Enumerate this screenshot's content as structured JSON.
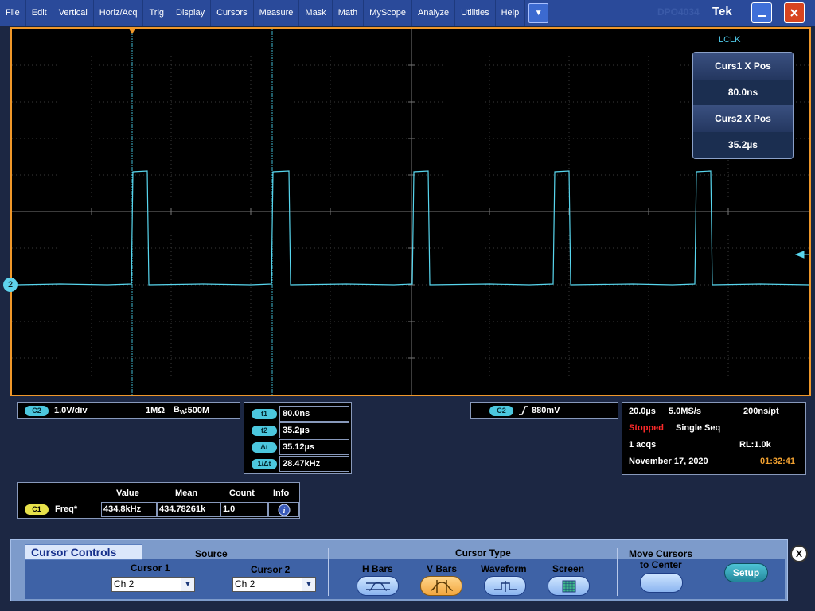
{
  "menu": [
    "File",
    "Edit",
    "Vertical",
    "Horiz/Acq",
    "Trig",
    "Display",
    "Cursors",
    "Measure",
    "Mask",
    "Math",
    "MyScope",
    "Analyze",
    "Utilities",
    "Help"
  ],
  "window": {
    "brand_text": "DPO4034",
    "logo": "Tek",
    "minimize_icon": "minimize-icon",
    "close_icon": "close-icon"
  },
  "colors": {
    "trace": "#58d6ee",
    "frame": "#f0982a",
    "menubar": "#2a4a9a",
    "stopped": "#ff2a2a",
    "clock": "#f0a030"
  },
  "waveform": {
    "channel_marker": "2",
    "label": "LCLK",
    "cursor_box": {
      "curs1_label": "Curs1 X Pos",
      "curs1_value": "80.0ns",
      "curs2_label": "Curs2 X Pos",
      "curs2_value": "35.2µs"
    }
  },
  "vertical": {
    "badge": "C2",
    "scale": "1.0V/div",
    "coupling": "1MΩ",
    "bw_prefix": "B",
    "bw_sub": "W",
    "bandwidth": ":500M"
  },
  "cursor_readout": [
    {
      "badge": "t1",
      "value": "80.0ns"
    },
    {
      "badge": "t2",
      "value": "35.2µs"
    },
    {
      "badge": "Δt",
      "value": "35.12µs"
    },
    {
      "badge": "1/Δt",
      "value": "28.47kHz"
    }
  ],
  "trigger": {
    "badge": "C2",
    "slope_icon": "rising-edge-icon",
    "level": "880mV"
  },
  "acquisition": {
    "timebase": "20.0µs",
    "sample_rate": "5.0MS/s",
    "resolution": "200ns/pt",
    "state": "Stopped",
    "mode": "Single Seq",
    "acqs": "1 acqs",
    "record_length": "RL:1.0k",
    "date": "November 17, 2020",
    "time": "01:32:41"
  },
  "measurements": {
    "headers": [
      "Value",
      "Mean",
      "Count",
      "Info"
    ],
    "rows": [
      {
        "badge": "C1",
        "name": "Freq*",
        "value": "434.8kHz",
        "mean": "434.78261k",
        "count": "1.0",
        "info_icon": "info-icon"
      }
    ]
  },
  "cursor_controls": {
    "title": "Cursor Controls",
    "source_label": "Source",
    "cursor1_label": "Cursor 1",
    "cursor1_value": "Ch 2",
    "cursor2_label": "Cursor 2",
    "cursor2_value": "Ch 2",
    "type_label": "Cursor Type",
    "types": [
      "H Bars",
      "V Bars",
      "Waveform",
      "Screen"
    ],
    "selected_type": "V Bars",
    "move_label_line1": "Move Cursors",
    "move_label_line2": "to Center",
    "setup_label": "Setup",
    "close_label": "X"
  }
}
